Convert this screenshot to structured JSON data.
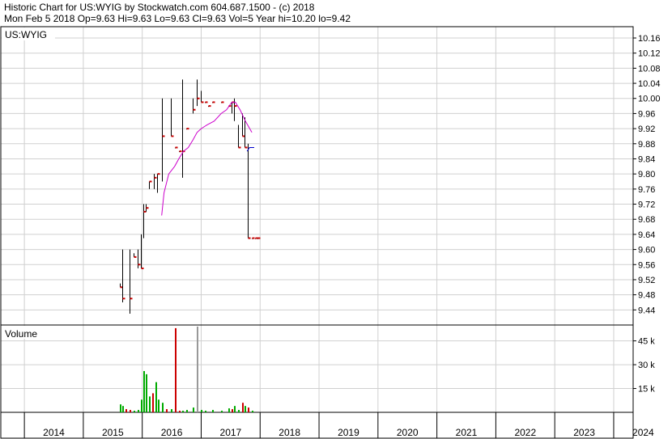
{
  "header": {
    "line1": "Historic Chart for US:WYIG by Stockwatch.com 604.687.1500 - (c) 2018",
    "line2": "Mon Feb  5 2018  Op=9.63  Hi=9.63  Lo=9.63  Cl=9.63  Vol=5  Year hi=10.20  lo=9.42"
  },
  "colors": {
    "up": "#00aa00",
    "down": "#cc0000",
    "neutral": "#999999",
    "ma_short": "#cc00cc",
    "ma_long": "#0000cc",
    "grid": "#d0d0d0",
    "bar": "#000000",
    "tick": "#cc0000"
  },
  "chart_data": [
    {
      "type": "line",
      "subtype": "ohlc",
      "symbol": "US:WYIG",
      "ylim": [
        9.4,
        10.19
      ],
      "y_ticks": [
        9.44,
        9.48,
        9.52,
        9.56,
        9.6,
        9.64,
        9.68,
        9.72,
        9.76,
        9.8,
        9.84,
        9.88,
        9.92,
        9.96,
        10.0,
        10.04,
        10.08,
        10.12,
        10.16
      ],
      "y_tick_labels": [
        "9.44",
        "9.48",
        "9.52",
        "9.56",
        "9.60",
        "9.64",
        "9.68",
        "9.72",
        "9.76",
        "9.80",
        "9.84",
        "9.88",
        "9.92",
        "9.96",
        "10.00",
        "10.04",
        "10.08",
        "10.12",
        "10.16"
      ],
      "x_ticks": [
        "2014",
        "2015",
        "2016",
        "2017",
        "2018",
        "2019",
        "2020",
        "2021",
        "2022",
        "2023",
        "2024"
      ],
      "xlim": [
        2013.6,
        2024.33
      ],
      "grid": true,
      "bars": [
        {
          "t": 2015.62,
          "h": 9.51,
          "l": 9.5,
          "c": 9.5
        },
        {
          "t": 2015.66,
          "h": 9.6,
          "l": 9.46,
          "c": 9.47
        },
        {
          "t": 2015.79,
          "h": 9.6,
          "l": 9.43,
          "c": 9.47
        },
        {
          "t": 2015.86,
          "h": 9.59,
          "l": 9.58,
          "c": 9.58
        },
        {
          "t": 2015.92,
          "h": 9.6,
          "l": 9.55,
          "c": 9.56
        },
        {
          "t": 2015.98,
          "h": 9.64,
          "l": 9.55,
          "c": 9.55
        },
        {
          "t": 2016.02,
          "h": 9.72,
          "l": 9.63,
          "c": 9.7
        },
        {
          "t": 2016.06,
          "h": 9.72,
          "l": 9.7,
          "c": 9.71
        },
        {
          "t": 2016.11,
          "h": 9.78,
          "l": 9.76,
          "c": 9.78
        },
        {
          "t": 2016.19,
          "h": 9.8,
          "l": 9.76,
          "c": 9.79
        },
        {
          "t": 2016.25,
          "h": 9.8,
          "l": 9.75,
          "c": 9.8
        },
        {
          "t": 2016.33,
          "h": 10.0,
          "l": 9.78,
          "c": 9.9
        },
        {
          "t": 2016.48,
          "h": 10.0,
          "l": 9.9,
          "c": 9.9
        },
        {
          "t": 2016.55,
          "h": 9.87,
          "l": 9.87,
          "c": 9.87
        },
        {
          "t": 2016.62,
          "h": 9.86,
          "l": 9.86,
          "c": 9.86
        },
        {
          "t": 2016.68,
          "h": 10.05,
          "l": 9.79,
          "c": 9.86
        },
        {
          "t": 2016.74,
          "h": 9.92,
          "l": 9.92,
          "c": 9.92
        },
        {
          "t": 2016.86,
          "h": 10.0,
          "l": 9.96,
          "c": 9.97
        },
        {
          "t": 2016.92,
          "h": 10.05,
          "l": 9.98,
          "c": 10.0
        },
        {
          "t": 2016.99,
          "h": 10.02,
          "l": 9.99,
          "c": 9.99
        },
        {
          "t": 2017.06,
          "h": 9.99,
          "l": 9.99,
          "c": 9.99
        },
        {
          "t": 2017.12,
          "h": 9.98,
          "l": 9.98,
          "c": 9.98
        },
        {
          "t": 2017.18,
          "h": 9.99,
          "l": 9.99,
          "c": 9.99
        },
        {
          "t": 2017.34,
          "h": 9.99,
          "l": 9.99,
          "c": 9.99
        },
        {
          "t": 2017.46,
          "h": 9.98,
          "l": 9.98,
          "c": 9.98
        },
        {
          "t": 2017.51,
          "h": 9.99,
          "l": 9.96,
          "c": 9.99
        },
        {
          "t": 2017.56,
          "h": 10.0,
          "l": 9.94,
          "c": 9.98
        },
        {
          "t": 2017.63,
          "h": 9.93,
          "l": 9.87,
          "c": 9.87
        },
        {
          "t": 2017.7,
          "h": 9.96,
          "l": 9.9,
          "c": 9.9
        },
        {
          "t": 2017.74,
          "h": 9.95,
          "l": 9.87,
          "c": 9.87
        },
        {
          "t": 2017.79,
          "h": 9.88,
          "l": 9.63,
          "c": 9.63
        },
        {
          "t": 2017.86,
          "h": 9.63,
          "l": 9.63,
          "c": 9.63
        },
        {
          "t": 2017.92,
          "h": 9.63,
          "l": 9.63,
          "c": 9.63
        },
        {
          "t": 2017.96,
          "h": 9.63,
          "l": 9.63,
          "c": 9.63
        }
      ],
      "ma_short": {
        "points": [
          [
            2016.33,
            9.69
          ],
          [
            2016.37,
            9.75
          ],
          [
            2016.45,
            9.8
          ],
          [
            2016.55,
            9.82
          ],
          [
            2016.62,
            9.84
          ],
          [
            2016.7,
            9.86
          ],
          [
            2016.78,
            9.87
          ],
          [
            2016.86,
            9.89
          ],
          [
            2016.93,
            9.91
          ],
          [
            2017.0,
            9.92
          ],
          [
            2017.1,
            9.93
          ],
          [
            2017.22,
            9.94
          ],
          [
            2017.34,
            9.96
          ],
          [
            2017.43,
            9.97
          ],
          [
            2017.52,
            9.99
          ],
          [
            2017.58,
            9.99
          ],
          [
            2017.66,
            9.97
          ],
          [
            2017.75,
            9.94
          ],
          [
            2017.86,
            9.91
          ]
        ]
      },
      "ma_long": {
        "points": [
          [
            2017.78,
            9.86
          ],
          [
            2017.82,
            9.87
          ],
          [
            2017.9,
            9.87
          ]
        ]
      }
    },
    {
      "type": "bar",
      "title": "Volume",
      "ylim": [
        0,
        55000
      ],
      "y_ticks": [
        15000,
        30000,
        45000
      ],
      "y_tick_labels": [
        "15 k",
        "30 k",
        "45 k"
      ],
      "vols": [
        {
          "t": 2015.62,
          "v": 5000,
          "c": "up"
        },
        {
          "t": 2015.66,
          "v": 4000,
          "c": "up"
        },
        {
          "t": 2015.72,
          "v": 2000,
          "c": "down"
        },
        {
          "t": 2015.79,
          "v": 1500,
          "c": "down"
        },
        {
          "t": 2015.86,
          "v": 1000,
          "c": "up"
        },
        {
          "t": 2015.92,
          "v": 1500,
          "c": "up"
        },
        {
          "t": 2015.98,
          "v": 8000,
          "c": "up"
        },
        {
          "t": 2016.02,
          "v": 26000,
          "c": "up"
        },
        {
          "t": 2016.06,
          "v": 24000,
          "c": "up"
        },
        {
          "t": 2016.11,
          "v": 10000,
          "c": "up"
        },
        {
          "t": 2016.17,
          "v": 12000,
          "c": "down"
        },
        {
          "t": 2016.23,
          "v": 19000,
          "c": "up"
        },
        {
          "t": 2016.27,
          "v": 8000,
          "c": "up"
        },
        {
          "t": 2016.33,
          "v": 6000,
          "c": "up"
        },
        {
          "t": 2016.4,
          "v": 2000,
          "c": "down"
        },
        {
          "t": 2016.48,
          "v": 2000,
          "c": "up"
        },
        {
          "t": 2016.55,
          "v": 53000,
          "c": "down"
        },
        {
          "t": 2016.62,
          "v": 1000,
          "c": "down"
        },
        {
          "t": 2016.68,
          "v": 1000,
          "c": "up"
        },
        {
          "t": 2016.74,
          "v": 1500,
          "c": "up"
        },
        {
          "t": 2016.86,
          "v": 3000,
          "c": "up"
        },
        {
          "t": 2016.92,
          "v": 54000,
          "c": "neutral"
        },
        {
          "t": 2016.99,
          "v": 1500,
          "c": "up"
        },
        {
          "t": 2017.06,
          "v": 1000,
          "c": "up"
        },
        {
          "t": 2017.18,
          "v": 1500,
          "c": "up"
        },
        {
          "t": 2017.34,
          "v": 1000,
          "c": "up"
        },
        {
          "t": 2017.46,
          "v": 2500,
          "c": "up"
        },
        {
          "t": 2017.51,
          "v": 2000,
          "c": "down"
        },
        {
          "t": 2017.56,
          "v": 4000,
          "c": "up"
        },
        {
          "t": 2017.63,
          "v": 1500,
          "c": "up"
        },
        {
          "t": 2017.7,
          "v": 6000,
          "c": "down"
        },
        {
          "t": 2017.74,
          "v": 4000,
          "c": "up"
        },
        {
          "t": 2017.79,
          "v": 3000,
          "c": "down"
        },
        {
          "t": 2017.86,
          "v": 1000,
          "c": "up"
        }
      ]
    }
  ]
}
